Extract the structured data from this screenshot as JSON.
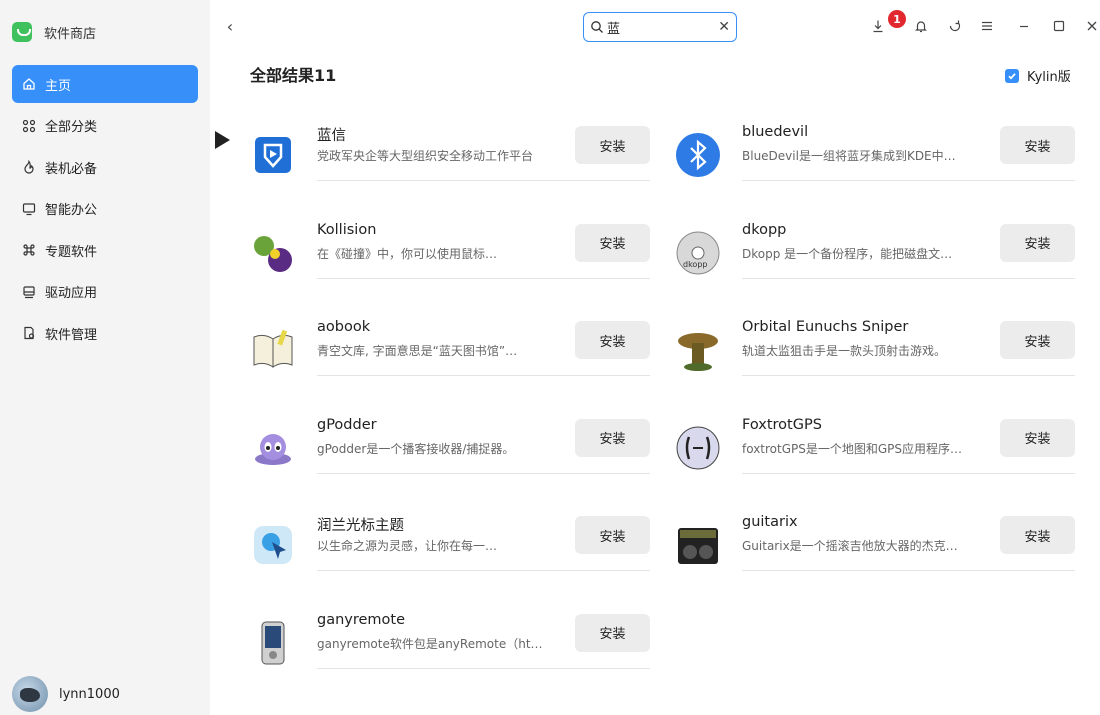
{
  "app": {
    "title": "软件商店",
    "user_name": "lynn1000"
  },
  "sidebar": {
    "items": [
      {
        "label": "主页",
        "icon": "home-icon",
        "active": true
      },
      {
        "label": "全部分类",
        "icon": "grid-icon"
      },
      {
        "label": "装机必备",
        "icon": "fire-icon"
      },
      {
        "label": "智能办公",
        "icon": "monitor-icon"
      },
      {
        "label": "专题软件",
        "icon": "command-icon"
      },
      {
        "label": "驱动应用",
        "icon": "driver-icon"
      },
      {
        "label": "软件管理",
        "icon": "manage-icon"
      }
    ]
  },
  "toolbar": {
    "search_value": "蓝",
    "download_count": "1"
  },
  "main": {
    "heading": "全部结果11",
    "kylin_label": "Kylin版",
    "kylin_checked": true
  },
  "apps": [
    {
      "name": "蓝信",
      "desc": "党政军央企等大型组织安全移动工作平台",
      "button": "安装",
      "icon": "lanxin-icon"
    },
    {
      "name": "bluedevil",
      "desc": "BlueDevil是一组将蓝牙集成到KDE中…",
      "button": "安装",
      "icon": "bluetooth-icon"
    },
    {
      "name": "Kollision",
      "desc": "在《碰撞》中，你可以使用鼠标…",
      "button": "安装",
      "icon": "kollision-icon"
    },
    {
      "name": "dkopp",
      "desc": "Dkopp 是一个备份程序，能把磁盘文…",
      "button": "安装",
      "icon": "disc-icon"
    },
    {
      "name": "aobook",
      "desc": "青空文库, 字面意思是“蓝天图书馆”…",
      "button": "安装",
      "icon": "book-icon"
    },
    {
      "name": "Orbital Eunuchs Sniper",
      "desc": "轨道太监狙击手是一款头顶射击游戏。",
      "button": "安装",
      "icon": "sniper-icon"
    },
    {
      "name": "gPodder",
      "desc": "gPodder是一个播客接收器/捕捉器。",
      "button": "安装",
      "icon": "gpodder-icon"
    },
    {
      "name": "FoxtrotGPS",
      "desc": "foxtrotGPS是一个地图和GPS应用程序…",
      "button": "安装",
      "icon": "foxtrot-icon"
    },
    {
      "name": "润兰光标主题",
      "desc": "以生命之源为灵感，让你在每一…",
      "button": "安装",
      "icon": "cursor-theme-icon"
    },
    {
      "name": "guitarix",
      "desc": "Guitarix是一个摇滚吉他放大器的杰克…",
      "button": "安装",
      "icon": "amplifier-icon"
    },
    {
      "name": "ganyremote",
      "desc": "ganyremote软件包是anyRemote（ht…",
      "button": "安装",
      "icon": "remote-icon"
    }
  ]
}
